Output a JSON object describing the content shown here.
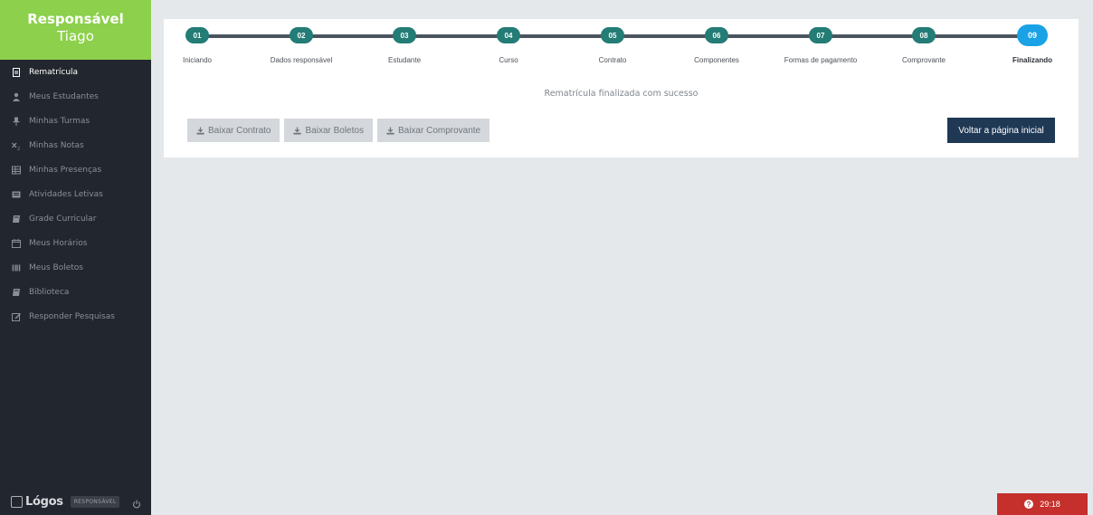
{
  "sidebar": {
    "role": "Responsável",
    "name": "Tiago",
    "items": [
      {
        "label": "Rematrícula",
        "icon": "document-icon",
        "active": true
      },
      {
        "label": "Meus Estudantes",
        "icon": "user-icon",
        "active": false
      },
      {
        "label": "Minhas Turmas",
        "icon": "pin-icon",
        "active": false
      },
      {
        "label": "Minhas Notas",
        "icon": "subscript-icon",
        "active": false
      },
      {
        "label": "Minhas Presenças",
        "icon": "table-icon",
        "active": false
      },
      {
        "label": "Atividades Letivas",
        "icon": "list-icon",
        "active": false
      },
      {
        "label": "Grade Curricular",
        "icon": "book-icon",
        "active": false
      },
      {
        "label": "Meus Horários",
        "icon": "calendar-icon",
        "active": false
      },
      {
        "label": "Meus Boletos",
        "icon": "barcode-icon",
        "active": false
      },
      {
        "label": "Biblioteca",
        "icon": "book-icon",
        "active": false
      },
      {
        "label": "Responder Pesquisas",
        "icon": "edit-icon",
        "active": false
      }
    ],
    "footer": {
      "logo_text": "Lógos",
      "role_badge": "RESPONSÁVEL"
    }
  },
  "stepper": {
    "steps": [
      {
        "number": "01",
        "label": "Iniciando"
      },
      {
        "number": "02",
        "label": "Dados responsável"
      },
      {
        "number": "03",
        "label": "Estudante"
      },
      {
        "number": "04",
        "label": "Curso"
      },
      {
        "number": "05",
        "label": "Contrato"
      },
      {
        "number": "06",
        "label": "Componentes"
      },
      {
        "number": "07",
        "label": "Formas de pagamento"
      },
      {
        "number": "08",
        "label": "Comprovante"
      },
      {
        "number": "09",
        "label": "Finalizando"
      }
    ],
    "current": "09"
  },
  "main": {
    "success_message": "Rematrícula finalizada com sucesso",
    "buttons": {
      "download_contract": "Baixar Contrato",
      "download_slips": "Baixar Boletos",
      "download_receipt": "Baixar Comprovante",
      "back_home": "Voltar a página inicial"
    }
  },
  "timer": {
    "value": "29:18"
  },
  "colors": {
    "sidebar_bg": "#22262e",
    "header_green": "#8cd04c",
    "step_done": "#237c75",
    "step_current": "#1aa2e6",
    "primary_button": "#1f3854",
    "timer_bg": "#c5302c"
  }
}
